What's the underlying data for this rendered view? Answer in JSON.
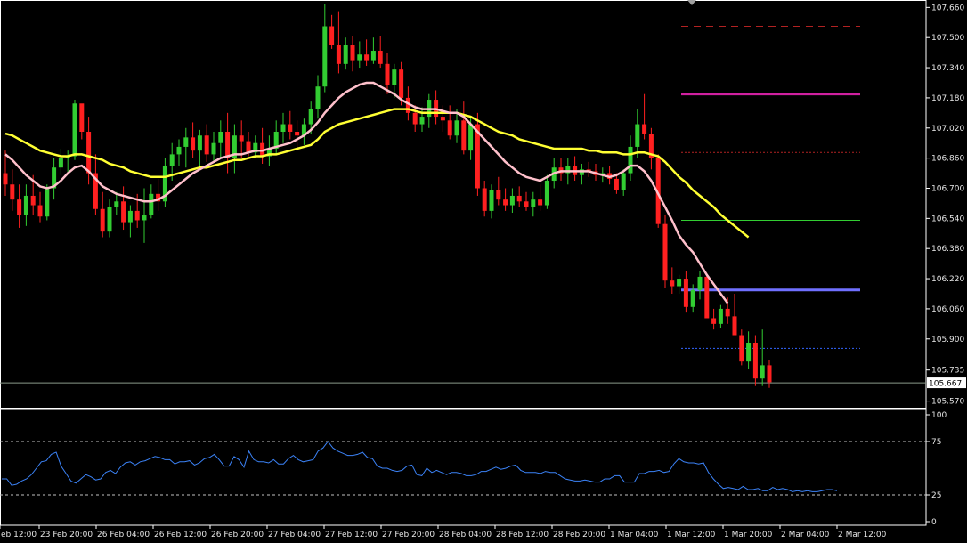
{
  "chart_data": [
    {
      "type": "candlestick",
      "title": "",
      "y_ticks": [
        "107.660",
        "107.500",
        "107.340",
        "107.180",
        "107.020",
        "106.860",
        "106.700",
        "106.540",
        "106.380",
        "106.220",
        "106.060",
        "105.900",
        "105.735",
        "105.570"
      ],
      "ylim": [
        105.535,
        107.69
      ],
      "current_price": "105.667",
      "candles": [
        [
          106.78,
          106.9,
          106.66,
          106.72
        ],
        [
          106.72,
          106.8,
          106.58,
          106.64
        ],
        [
          106.64,
          106.72,
          106.49,
          106.56
        ],
        [
          106.56,
          106.72,
          106.5,
          106.66
        ],
        [
          106.66,
          106.77,
          106.56,
          106.61
        ],
        [
          106.61,
          106.68,
          106.52,
          106.55
        ],
        [
          106.55,
          106.72,
          106.53,
          106.7
        ],
        [
          106.7,
          106.86,
          106.64,
          106.81
        ],
        [
          106.81,
          106.91,
          106.77,
          106.86
        ],
        [
          106.86,
          106.9,
          106.78,
          106.87
        ],
        [
          106.87,
          107.17,
          106.85,
          107.15
        ],
        [
          107.15,
          107.1,
          106.96,
          107.0
        ],
        [
          107.0,
          107.08,
          106.72,
          106.78
        ],
        [
          106.78,
          106.88,
          106.56,
          106.59
        ],
        [
          106.59,
          106.68,
          106.44,
          106.47
        ],
        [
          106.47,
          106.64,
          106.44,
          106.6
        ],
        [
          106.6,
          106.68,
          106.56,
          106.63
        ],
        [
          106.63,
          106.71,
          106.48,
          106.52
        ],
        [
          106.52,
          106.61,
          106.44,
          106.58
        ],
        [
          106.58,
          106.67,
          106.49,
          106.53
        ],
        [
          106.53,
          106.7,
          106.41,
          106.56
        ],
        [
          106.56,
          106.72,
          106.54,
          106.67
        ],
        [
          106.67,
          106.75,
          106.58,
          106.63
        ],
        [
          106.63,
          106.86,
          106.6,
          106.82
        ],
        [
          106.82,
          106.94,
          106.74,
          106.88
        ],
        [
          106.88,
          106.96,
          106.82,
          106.92
        ],
        [
          106.92,
          107.02,
          106.81,
          106.97
        ],
        [
          106.97,
          107.05,
          106.86,
          106.9
        ],
        [
          106.9,
          107.01,
          106.82,
          106.98
        ],
        [
          106.98,
          107.04,
          106.84,
          106.88
        ],
        [
          106.88,
          107.0,
          106.84,
          106.94
        ],
        [
          106.94,
          107.06,
          106.86,
          107.0
        ],
        [
          107.0,
          107.1,
          106.78,
          106.86
        ],
        [
          106.86,
          107.04,
          106.78,
          106.98
        ],
        [
          106.98,
          107.06,
          106.86,
          106.95
        ],
        [
          106.95,
          107.0,
          106.87,
          106.89
        ],
        [
          106.89,
          106.98,
          106.86,
          106.94
        ],
        [
          106.94,
          107.02,
          106.83,
          106.87
        ],
        [
          106.87,
          106.98,
          106.82,
          106.91
        ],
        [
          106.91,
          107.06,
          106.88,
          107.0
        ],
        [
          107.0,
          107.1,
          106.94,
          107.04
        ],
        [
          107.04,
          107.11,
          106.96,
          107.0
        ],
        [
          107.0,
          107.06,
          106.9,
          106.98
        ],
        [
          106.98,
          107.07,
          106.93,
          107.04
        ],
        [
          107.04,
          107.16,
          106.99,
          107.12
        ],
        [
          107.12,
          107.3,
          107.07,
          107.24
        ],
        [
          107.24,
          107.68,
          107.21,
          107.56
        ],
        [
          107.56,
          107.62,
          107.44,
          107.46
        ],
        [
          107.46,
          107.64,
          107.31,
          107.36
        ],
        [
          107.36,
          107.5,
          107.33,
          107.46
        ],
        [
          107.46,
          107.51,
          107.32,
          107.38
        ],
        [
          107.38,
          107.48,
          107.34,
          107.41
        ],
        [
          107.41,
          107.49,
          107.35,
          107.38
        ],
        [
          107.38,
          107.5,
          107.36,
          107.43
        ],
        [
          107.43,
          107.51,
          107.34,
          107.36
        ],
        [
          107.36,
          107.42,
          107.2,
          107.25
        ],
        [
          107.25,
          107.36,
          107.18,
          107.33
        ],
        [
          107.33,
          107.37,
          107.14,
          107.18
        ],
        [
          107.18,
          107.24,
          107.06,
          107.1
        ],
        [
          107.1,
          107.14,
          107.0,
          107.04
        ],
        [
          107.04,
          107.13,
          107.0,
          107.08
        ],
        [
          107.08,
          107.2,
          107.02,
          107.17
        ],
        [
          107.17,
          107.22,
          107.04,
          107.08
        ],
        [
          107.08,
          107.14,
          107.0,
          107.06
        ],
        [
          107.06,
          107.14,
          106.96,
          106.98
        ],
        [
          106.98,
          107.12,
          106.94,
          107.06
        ],
        [
          107.06,
          107.16,
          106.88,
          106.9
        ],
        [
          106.9,
          107.08,
          106.85,
          107.04
        ],
        [
          107.04,
          107.1,
          106.66,
          106.7
        ],
        [
          106.7,
          106.74,
          106.55,
          106.58
        ],
        [
          106.58,
          106.72,
          106.54,
          106.69
        ],
        [
          106.69,
          106.76,
          106.61,
          106.64
        ],
        [
          106.64,
          106.7,
          106.58,
          106.61
        ],
        [
          106.61,
          106.7,
          106.57,
          106.66
        ],
        [
          106.66,
          106.71,
          106.6,
          106.63
        ],
        [
          106.63,
          106.68,
          106.58,
          106.6
        ],
        [
          106.6,
          106.68,
          106.55,
          106.64
        ],
        [
          106.64,
          106.72,
          106.58,
          106.61
        ],
        [
          106.61,
          106.77,
          106.59,
          106.74
        ],
        [
          106.74,
          106.86,
          106.7,
          106.81
        ],
        [
          106.81,
          106.86,
          106.74,
          106.78
        ],
        [
          106.78,
          106.86,
          106.72,
          106.82
        ],
        [
          106.82,
          106.87,
          106.74,
          106.77
        ],
        [
          106.77,
          106.83,
          106.72,
          106.8
        ],
        [
          106.8,
          106.84,
          106.76,
          106.79
        ],
        [
          106.79,
          106.83,
          106.74,
          106.77
        ],
        [
          106.77,
          106.81,
          106.73,
          106.78
        ],
        [
          106.78,
          106.82,
          106.72,
          106.75
        ],
        [
          106.75,
          106.78,
          106.67,
          106.69
        ],
        [
          106.69,
          106.8,
          106.66,
          106.78
        ],
        [
          106.78,
          106.98,
          106.74,
          106.92
        ],
        [
          106.92,
          107.12,
          106.86,
          107.04
        ],
        [
          107.04,
          107.2,
          106.96,
          106.99
        ],
        [
          106.99,
          107.02,
          106.8,
          106.86
        ],
        [
          106.86,
          106.88,
          106.49,
          106.51
        ],
        [
          106.51,
          106.56,
          106.17,
          106.21
        ],
        [
          106.21,
          106.28,
          106.14,
          106.18
        ],
        [
          106.18,
          106.24,
          106.14,
          106.22
        ],
        [
          106.22,
          106.26,
          106.04,
          106.07
        ],
        [
          106.07,
          106.19,
          106.04,
          106.16
        ],
        [
          106.16,
          106.26,
          106.11,
          106.23
        ],
        [
          106.23,
          106.25,
          106.05,
          106.01
        ],
        [
          106.01,
          106.06,
          105.95,
          105.98
        ],
        [
          105.98,
          106.08,
          105.96,
          106.06
        ],
        [
          106.06,
          106.12,
          105.98,
          106.02
        ],
        [
          106.02,
          106.14,
          105.96,
          105.92
        ],
        [
          105.92,
          105.95,
          105.76,
          105.78
        ],
        [
          105.78,
          105.94,
          105.74,
          105.88
        ],
        [
          105.88,
          105.92,
          105.65,
          105.69
        ],
        [
          105.69,
          105.95,
          105.65,
          105.76
        ],
        [
          105.76,
          105.79,
          105.64,
          105.67
        ]
      ],
      "ma_slow": [
        106.99,
        106.98,
        106.96,
        106.94,
        106.92,
        106.9,
        106.89,
        106.88,
        106.87,
        106.87,
        106.88,
        106.88,
        106.87,
        106.86,
        106.85,
        106.83,
        106.82,
        106.81,
        106.79,
        106.78,
        106.77,
        106.76,
        106.76,
        106.76,
        106.77,
        106.78,
        106.79,
        106.8,
        106.81,
        106.81,
        106.82,
        106.83,
        106.84,
        106.85,
        106.85,
        106.86,
        106.87,
        106.87,
        106.88,
        106.88,
        106.89,
        106.9,
        106.91,
        106.92,
        106.93,
        106.96,
        107.0,
        107.02,
        107.04,
        107.05,
        107.06,
        107.07,
        107.08,
        107.09,
        107.1,
        107.11,
        107.12,
        107.12,
        107.12,
        107.11,
        107.1,
        107.1,
        107.1,
        107.1,
        107.1,
        107.1,
        107.09,
        107.08,
        107.06,
        107.04,
        107.02,
        107.0,
        106.99,
        106.98,
        106.96,
        106.95,
        106.94,
        106.93,
        106.92,
        106.91,
        106.91,
        106.91,
        106.91,
        106.91,
        106.9,
        106.9,
        106.89,
        106.89,
        106.89,
        106.88,
        106.88,
        106.89,
        106.89,
        106.88,
        106.87,
        106.84,
        106.8,
        106.76,
        106.73,
        106.69,
        106.66,
        106.63,
        106.6,
        106.56,
        106.53,
        106.5,
        106.47,
        106.44
      ],
      "ma_fast": [
        106.88,
        106.85,
        106.81,
        106.77,
        106.74,
        106.71,
        106.7,
        106.71,
        106.74,
        106.78,
        106.81,
        106.82,
        106.79,
        106.75,
        106.71,
        106.69,
        106.67,
        106.66,
        106.65,
        106.64,
        106.63,
        106.63,
        106.64,
        106.66,
        106.69,
        106.72,
        106.75,
        106.78,
        106.8,
        106.82,
        106.84,
        106.86,
        106.87,
        106.88,
        106.88,
        106.89,
        106.9,
        106.9,
        106.91,
        106.92,
        106.93,
        106.94,
        106.96,
        106.98,
        107.01,
        107.05,
        107.1,
        107.14,
        107.18,
        107.21,
        107.23,
        107.25,
        107.26,
        107.26,
        107.24,
        107.22,
        107.2,
        107.17,
        107.15,
        107.13,
        107.12,
        107.12,
        107.12,
        107.11,
        107.1,
        107.1,
        107.08,
        107.04,
        107.0,
        106.96,
        106.92,
        106.88,
        106.84,
        106.81,
        106.78,
        106.76,
        106.75,
        106.74,
        106.76,
        106.78,
        106.79,
        106.79,
        106.79,
        106.79,
        106.79,
        106.78,
        106.77,
        106.76,
        106.77,
        106.79,
        106.82,
        106.82,
        106.79,
        106.74,
        106.67,
        106.6,
        106.53,
        106.45,
        106.4,
        106.36,
        106.3,
        106.24,
        106.19,
        106.14,
        106.09
      ],
      "levels": [
        {
          "price": 107.56,
          "color": "#b22222",
          "style": "dashed"
        },
        {
          "price": 107.2,
          "color": "#d020a0",
          "style": "solid"
        },
        {
          "price": 106.89,
          "color": "#b22222",
          "style": "dotted"
        },
        {
          "price": 106.53,
          "color": "#32cd32",
          "style": "solid"
        },
        {
          "price": 106.16,
          "color": "#7070ff",
          "style": "solid"
        },
        {
          "price": 105.85,
          "color": "#3366ff",
          "style": "dotted"
        },
        {
          "price": 105.667,
          "color": "#8a9a8a",
          "style": "solid"
        }
      ],
      "colors": {
        "up": "#32cd32",
        "down": "#ff2020",
        "ma_slow": "#ffff33",
        "ma_fast": "#ffc0cb"
      }
    },
    {
      "type": "line",
      "title": "",
      "y_ticks": [
        "100",
        "75",
        "25",
        "0"
      ],
      "ylim": [
        0,
        100
      ],
      "levels": [
        75,
        25
      ],
      "color": "#3b82f6",
      "values": [
        40,
        40,
        34,
        35,
        38,
        40,
        44,
        50,
        56,
        57,
        63,
        65,
        52,
        45,
        38,
        36,
        40,
        44,
        42,
        39,
        40,
        46,
        48,
        45,
        51,
        55,
        56,
        53,
        56,
        57,
        59,
        61,
        60,
        58,
        58,
        54,
        56,
        56,
        57,
        53,
        55,
        59,
        60,
        63,
        58,
        52,
        52,
        61,
        58,
        51,
        66,
        58,
        56,
        56,
        55,
        58,
        54,
        54,
        59,
        62,
        58,
        56,
        57,
        58,
        66,
        69,
        75,
        69,
        66,
        64,
        62,
        62,
        63,
        65,
        60,
        59,
        52,
        50,
        50,
        48,
        47,
        48,
        52,
        53,
        44,
        43,
        50,
        46,
        48,
        46,
        44,
        46,
        46,
        45,
        43,
        43,
        44,
        47,
        47,
        49,
        51,
        49,
        50,
        52,
        53,
        48,
        46,
        46,
        46,
        45,
        47,
        46,
        46,
        43,
        40,
        39,
        38,
        38,
        39,
        38,
        37,
        37,
        40,
        40,
        43,
        43,
        37,
        37,
        37,
        45,
        45,
        47,
        47,
        48,
        46,
        47,
        54,
        59,
        56,
        55,
        55,
        54,
        55,
        46,
        40,
        35,
        31,
        32,
        31,
        30,
        33,
        30,
        30,
        31,
        29,
        29,
        32,
        30,
        31,
        30,
        28,
        29,
        28,
        29,
        28,
        28,
        29,
        30,
        30,
        29
      ]
    }
  ],
  "x_labels": [
    "eb 12:00",
    "23 Feb 20:00",
    "26 Feb 04:00",
    "26 Feb 12:00",
    "26 Feb 20:00",
    "27 Feb 04:00",
    "27 Feb 12:00",
    "27 Feb 20:00",
    "28 Feb 04:00",
    "28 Feb 12:00",
    "28 Feb 20:00",
    "1 Mar 04:00",
    "1 Mar 12:00",
    "1 Mar 20:00",
    "2 Mar 04:00",
    "2 Mar 12:00"
  ]
}
